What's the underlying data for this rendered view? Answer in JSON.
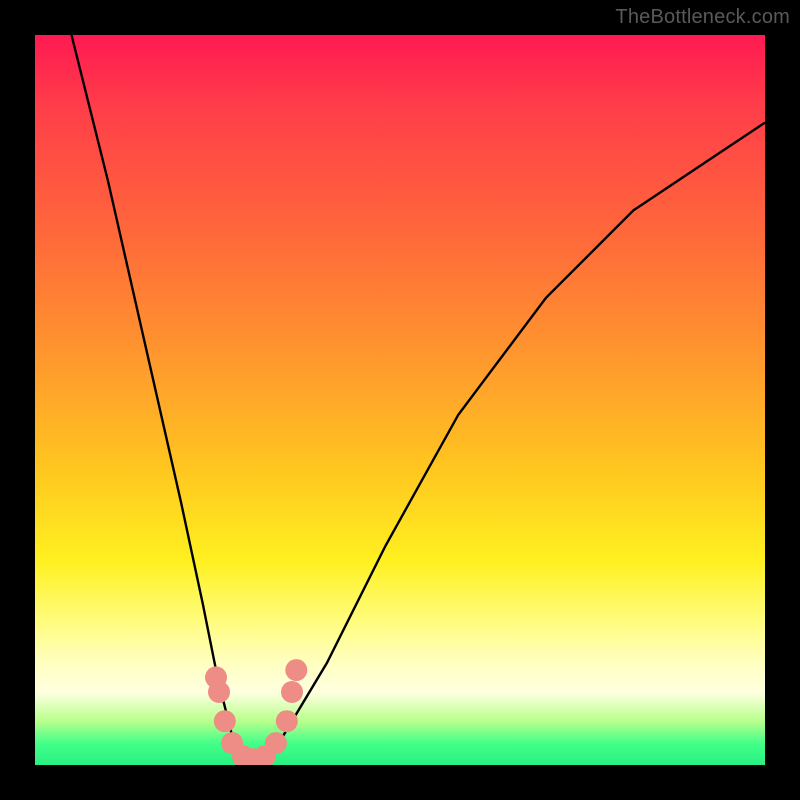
{
  "watermark": "TheBottleneck.com",
  "chart_data": {
    "type": "line",
    "title": "",
    "xlabel": "",
    "ylabel": "",
    "xlim": [
      0,
      100
    ],
    "ylim": [
      0,
      100
    ],
    "series": [
      {
        "name": "bottleneck-curve",
        "x": [
          5,
          10,
          15,
          20,
          23,
          25,
          27,
          28.5,
          30,
          32,
          34,
          40,
          48,
          58,
          70,
          82,
          94,
          100
        ],
        "values": [
          100,
          80,
          58,
          36,
          22,
          12,
          4,
          1,
          0,
          1,
          4,
          14,
          30,
          48,
          64,
          76,
          84,
          88
        ]
      }
    ],
    "markers": [
      {
        "name": "dot",
        "x": 24.8,
        "y": 12
      },
      {
        "name": "dot",
        "x": 25.2,
        "y": 10
      },
      {
        "name": "dot",
        "x": 26.0,
        "y": 6
      },
      {
        "name": "dot",
        "x": 27.0,
        "y": 3
      },
      {
        "name": "dot",
        "x": 28.5,
        "y": 1.2
      },
      {
        "name": "dot",
        "x": 30.0,
        "y": 0.8
      },
      {
        "name": "dot",
        "x": 31.5,
        "y": 1.2
      },
      {
        "name": "dot",
        "x": 33.0,
        "y": 3
      },
      {
        "name": "dot",
        "x": 34.5,
        "y": 6
      },
      {
        "name": "dot",
        "x": 35.2,
        "y": 10
      },
      {
        "name": "dot",
        "x": 35.8,
        "y": 13
      }
    ],
    "marker_color": "#ed8d86",
    "curve_color": "#000000",
    "background_gradient_stops": [
      {
        "pos": 0,
        "color": "#ff1a52"
      },
      {
        "pos": 60,
        "color": "#ffc81f"
      },
      {
        "pos": 85,
        "color": "#ffffc0"
      },
      {
        "pos": 97,
        "color": "#44ff88"
      }
    ]
  }
}
